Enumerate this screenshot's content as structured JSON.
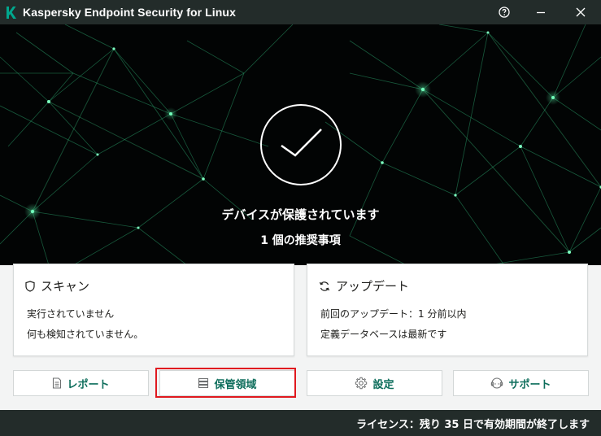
{
  "window": {
    "title": "Kaspersky Endpoint Security for Linux",
    "accent_color": "#0e6e5c",
    "titlebar_color": "#232c2a"
  },
  "titlebar": {
    "buttons": [
      "help-icon",
      "minimize-icon",
      "close-icon"
    ]
  },
  "hero": {
    "status_title": "デバイスが保護されています",
    "recommendations": "1 個の推奨事項",
    "icon": "checkmark-circle-icon"
  },
  "cards": {
    "scan": {
      "title": "スキャン",
      "icon": "shield-icon",
      "line1": "実行されていません",
      "line2": "何も検知されていません。"
    },
    "update": {
      "title": "アップデート",
      "icon": "refresh-icon",
      "line1": "前回のアップデート：1 分前以内",
      "line2": "定義データベースは最新です"
    }
  },
  "actions": {
    "report": {
      "label": "レポート",
      "icon": "document-icon"
    },
    "quarantine": {
      "label": "保管領域",
      "icon": "storage-icon"
    },
    "settings": {
      "label": "設定",
      "icon": "gear-icon"
    },
    "support": {
      "label": "サポート",
      "icon": "support-icon"
    }
  },
  "footer": {
    "license": "ライセンス：残り 35 日で有効期間が終了します"
  },
  "highlight_color": "#e0191f"
}
